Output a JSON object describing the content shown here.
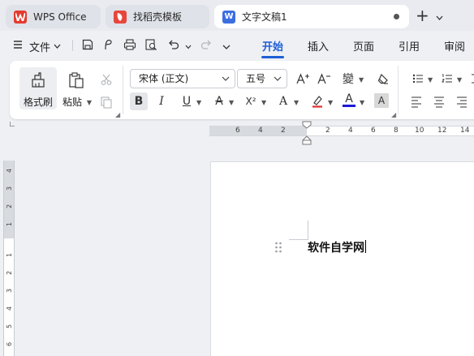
{
  "titlebar": {
    "tabs": [
      {
        "label": "WPS Office",
        "icon": "wps-logo-icon"
      },
      {
        "label": "找稻壳模板",
        "icon": "docer-logo-icon"
      },
      {
        "label": "文字文稿1",
        "icon": "writer-doc-icon",
        "logo_letter": "W",
        "active": true
      }
    ],
    "new_tab": "+"
  },
  "menu": {
    "file_label": "文件",
    "tabs": [
      "开始",
      "插入",
      "页面",
      "引用",
      "审阅"
    ],
    "active_tab": "开始"
  },
  "ribbon": {
    "format_painter": "格式刷",
    "paste": "粘贴",
    "font_name": "宋体 (正文)",
    "font_size": "五号",
    "bold": "B",
    "italic": "I",
    "underline": "U",
    "strikethrough": "A",
    "superscript": "X²",
    "text_effect": "A",
    "font_color": "A",
    "char_shade": "A",
    "phonetic": "變",
    "colors": {
      "accent": "#1f5fd6",
      "font_color_bar": "#1a1ad6",
      "highlight_bar": "#e03030"
    }
  },
  "ruler": {
    "horizontal": [
      "6",
      "4",
      "2",
      "2",
      "4",
      "6",
      "8",
      "10",
      "12",
      "14"
    ],
    "vertical": [
      "4",
      "3",
      "2",
      "1",
      "1",
      "2",
      "3",
      "4",
      "5",
      "6"
    ]
  },
  "document": {
    "text": "软件自学网"
  }
}
